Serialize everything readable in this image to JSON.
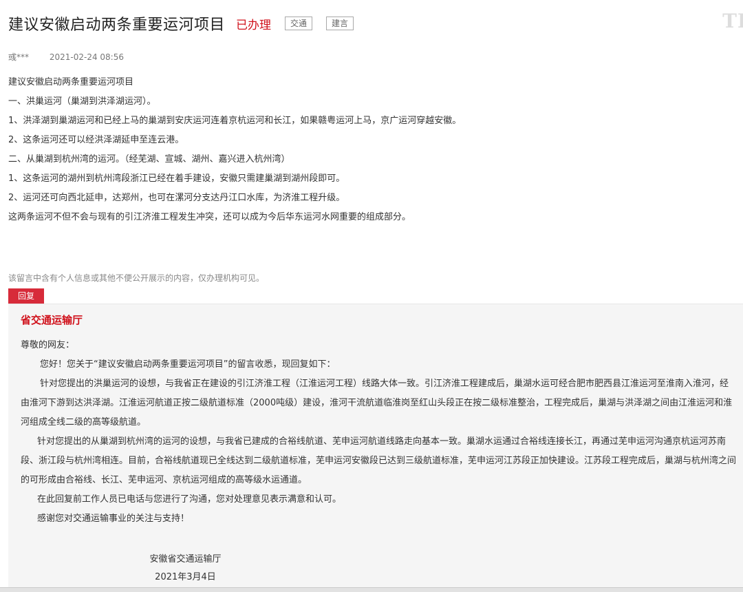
{
  "header": {
    "title": "建议安徽启动两条重要运河项目",
    "status": "已办理",
    "tags": [
      "交通",
      "建言"
    ],
    "watermark": "TI"
  },
  "meta": {
    "author": "彧***",
    "date": "2021-02-24 08:56"
  },
  "message": {
    "paragraphs": [
      "建议安徽启动两条重要运河项目",
      "一、洪巢运河（巢湖到洪泽湖运河）。",
      "1、洪泽湖到巢湖运河和已经上马的巢湖到安庆运河连着京杭运河和长江，如果赣粤运河上马，京广运河穿越安徽。",
      "2、这条运河还可以经洪泽湖延申至连云港。",
      "二、从巢湖到杭州湾的运河。（经芜湖、宣城、湖州、嘉兴进入杭州湾）",
      "1、这条运河的湖州到杭州湾段浙江已经在着手建设，安徽只需建巢湖到湖州段即可。",
      "2、运河还可向西北延申，达郑州，也可在漯河分支达丹江口水库，为济淮工程升级。",
      "这两条运河不但不会与现有的引江济淮工程发生冲突，还可以成为今后华东运河水网重要的组成部分。"
    ]
  },
  "privacy_note": "该留言中含有个人信息或其他不便公开展示的内容，仅办理机构可见。",
  "reply": {
    "tab_label": "回复",
    "organization": "省交通运输厅",
    "greeting": "尊敬的网友：",
    "intro": "您好！您关于“建议安徽启动两条重要运河项目”的留言收悉，现回复如下：",
    "para1": "针对您提出的洪巢运河的设想，与我省正在建设的引江济淮工程（江淮运河工程）线路大体一致。引江济淮工程建成后，巢湖水运可经合肥市肥西县江淮运河至淮南入淮河，经由淮河下游到达洪泽湖。江淮运河航道正按二级航道标准（2000吨级）建设，淮河干流航道临淮岗至红山头段正在按二级标准整治，工程完成后，巢湖与洪泽湖之间由江淮运河和淮河组成全线二级的高等级航道。",
    "para2": "针对您提出的从巢湖到杭州湾的运河的设想，与我省已建成的合裕线航道、芜申运河航道线路走向基本一致。巢湖水运通过合裕线连接长江，再通过芜申运河沟通京杭运河苏南段、浙江段与杭州湾相连。目前，合裕线航道现已全线达到二级航道标准，芜申运河安徽段已达到三级航道标准，芜申运河江苏段正加快建设。江苏段工程完成后，巢湖与杭州湾之间的可形成由合裕线、长江、芜申运河、京杭运河组成的高等级水运通道。",
    "para3": "在此回复前工作人员已电话与您进行了沟通，您对处理意见表示满意和认可。",
    "para4": "感谢您对交通运输事业的关注与支持！",
    "signature_org": "安徽省交通运输厅",
    "signature_date": "2021年3月4日"
  }
}
